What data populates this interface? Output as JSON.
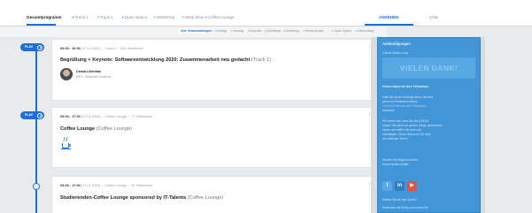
{
  "tabs": [
    {
      "label": "Gesamtprogramm"
    },
    {
      "label": "Track 1"
    },
    {
      "label": "Track 1"
    },
    {
      "label": "Open Space"
    },
    {
      "label": "Workshop"
    },
    {
      "label": "Deep Dive"
    },
    {
      "label": "Coffee Lounge"
    }
  ],
  "right_tabs": [
    {
      "label": "ANSEHEN"
    },
    {
      "label": "Chat"
    }
  ],
  "filters": [
    {
      "label": "Alle Veranstaltungen"
    },
    {
      "label": "Vortrag"
    },
    {
      "label": "Vortrag"
    },
    {
      "label": "Keynote"
    },
    {
      "label": "Workshop"
    },
    {
      "label": "Workshop"
    },
    {
      "label": "Meeta Austin"
    },
    {
      "label": "Open Space"
    },
    {
      "label": "Networking"
    }
  ],
  "play_label": "PLAY",
  "sessions": [
    {
      "time": "09:00 - 10:00",
      "date": "(17.01.2020)",
      "track": "Track 1",
      "attendees": "290 Teilnehmer",
      "title": "Begrüßung + Keynote: Softwareentwicklung 2020: Zusammenarbeit neu gedacht",
      "location": "(Track 1)",
      "speaker": "Carola Lilienthal",
      "speaker_org": "WPS - Workplace Solutions"
    },
    {
      "time": "09:00 - 17:00",
      "date": "(17.01.2020)",
      "track": "Coffee Lounge",
      "attendees": "77 Teilnehmer",
      "title": "Coffee Lounge",
      "location": "(Coffee Lounge)"
    },
    {
      "time": "09:00 - 17:00",
      "date": "(17.01.2020)",
      "track": "Coffee Lounge",
      "attendees": "42 Teilnehmer",
      "title": "Studierenden-Coffee Lounge sponsored by IT-Talents",
      "location": "(Coffee Lounge)"
    }
  ],
  "announcements": {
    "heading": "Ankündigungen",
    "sub": "Carola Zürich Lavis",
    "banner": "VIELEN DANK!",
    "bold": "Vielen Dank für Ihre Teilnahme",
    "lines": [
      "Falls Sie an der Umfrage lesen, Sie sind",
      "gerne im Feedback erheben",
      "in Ihrem Profil oder bei Teilnehmern",
      "einfinden!",
      "Wir freuen uns, dass Sie die ICALDA",
      "Digital, Sie waren so großen Erfolg, gemeinsam",
      "haben und hoffen Sie auch auf",
      "zukünftigen. Gerne sehen wir Sie auch",
      "am nächsten Termin.",
      "Werden Sie Mitglied unserer",
      "Social Media Kanäle:",
      "Klicken Sie auf das Symbol",
      "Entdecken mit Erfolg und Lernen Sie"
    ]
  },
  "social": [
    {
      "name": "twitter-icon",
      "glyph": "t"
    },
    {
      "name": "linkedin-icon",
      "glyph": "in"
    },
    {
      "name": "youtube-icon",
      "glyph": "▶"
    }
  ]
}
